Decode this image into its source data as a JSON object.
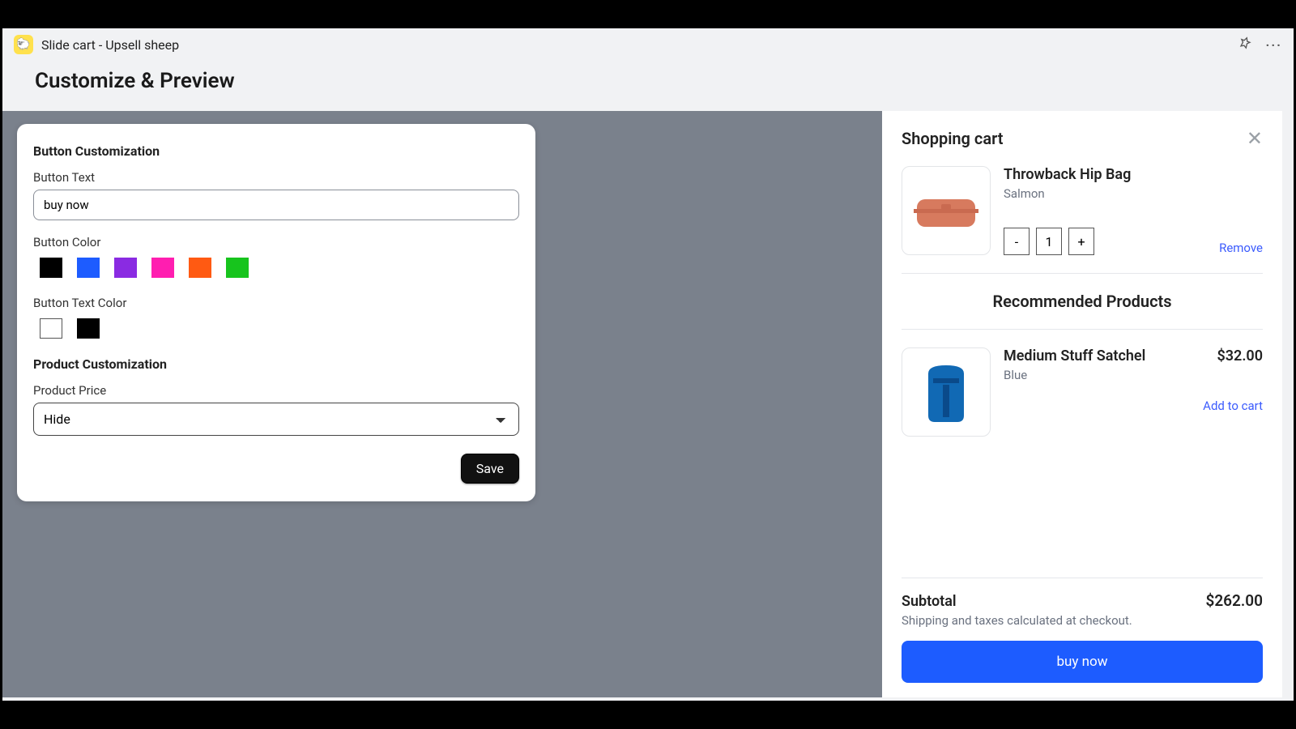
{
  "titlebar": {
    "app_name": "Slide cart - Upsell sheep"
  },
  "header": {
    "title": "Customize & Preview"
  },
  "panel": {
    "section1_title": "Button Customization",
    "button_text_label": "Button Text",
    "button_text_value": "buy now",
    "button_color_label": "Button Color",
    "button_colors": [
      "#000000",
      "#1d5cff",
      "#8a2be2",
      "#ff1eb0",
      "#ff5a12",
      "#17c41d"
    ],
    "button_text_color_label": "Button Text Color",
    "button_text_colors": [
      "#ffffff",
      "#000000"
    ],
    "section2_title": "Product Customization",
    "product_price_label": "Product Price",
    "product_price_value": "Hide",
    "save_label": "Save"
  },
  "cart": {
    "title": "Shopping cart",
    "item": {
      "name": "Throwback Hip Bag",
      "variant": "Salmon",
      "qty": "1",
      "remove_label": "Remove"
    },
    "recommended_title": "Recommended Products",
    "rec": {
      "name": "Medium Stuff Satchel",
      "variant": "Blue",
      "price": "$32.00",
      "add_label": "Add to cart"
    },
    "subtotal_label": "Subtotal",
    "subtotal_value": "$262.00",
    "shipping_note": "Shipping and taxes calculated at checkout.",
    "checkout_label": "buy now"
  },
  "colors": {
    "checkout_btn": "#1d5cff"
  }
}
